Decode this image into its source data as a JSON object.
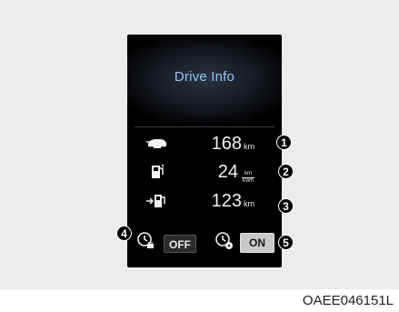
{
  "title": "Drive Info",
  "rows": [
    {
      "icon": "car-range-icon",
      "value": "168",
      "unit": "km",
      "callout": "1"
    },
    {
      "icon": "fuel-pump-icon",
      "value": "24",
      "unit_top": "km",
      "unit_bottom": "kWh",
      "callout": "2"
    },
    {
      "icon": "charge-range-icon",
      "value": "123",
      "unit": "km",
      "callout": "3"
    }
  ],
  "toggles": {
    "left": {
      "icon": "clock-plug-icon",
      "label": "OFF",
      "callout": "4"
    },
    "right": {
      "icon": "clock-fan-icon",
      "label": "ON",
      "callout": "5"
    }
  },
  "figure_code": "OAEE046151L"
}
